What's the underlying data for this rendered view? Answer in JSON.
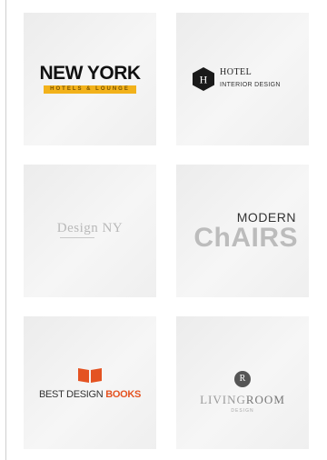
{
  "tiles": {
    "new_york": {
      "title": "NEW YORK",
      "tagline": "HOTELS & LOUNGE",
      "accent": "#f2b21b"
    },
    "hotel": {
      "monogram": "H",
      "title": "HOTEL",
      "subtitle": "INTERIOR DESIGN"
    },
    "design_ny": {
      "title": "Design NY"
    },
    "modern_chairs": {
      "top_word": "MODERN",
      "main_word": "ChAIRS"
    },
    "books": {
      "prefix": "BEST DESIGN ",
      "highlight": "BOOKS",
      "accent": "#e45322"
    },
    "living_room": {
      "monogram": "R",
      "living": "LIVING",
      "room": "ROOM",
      "sub": "DESIGN"
    }
  }
}
